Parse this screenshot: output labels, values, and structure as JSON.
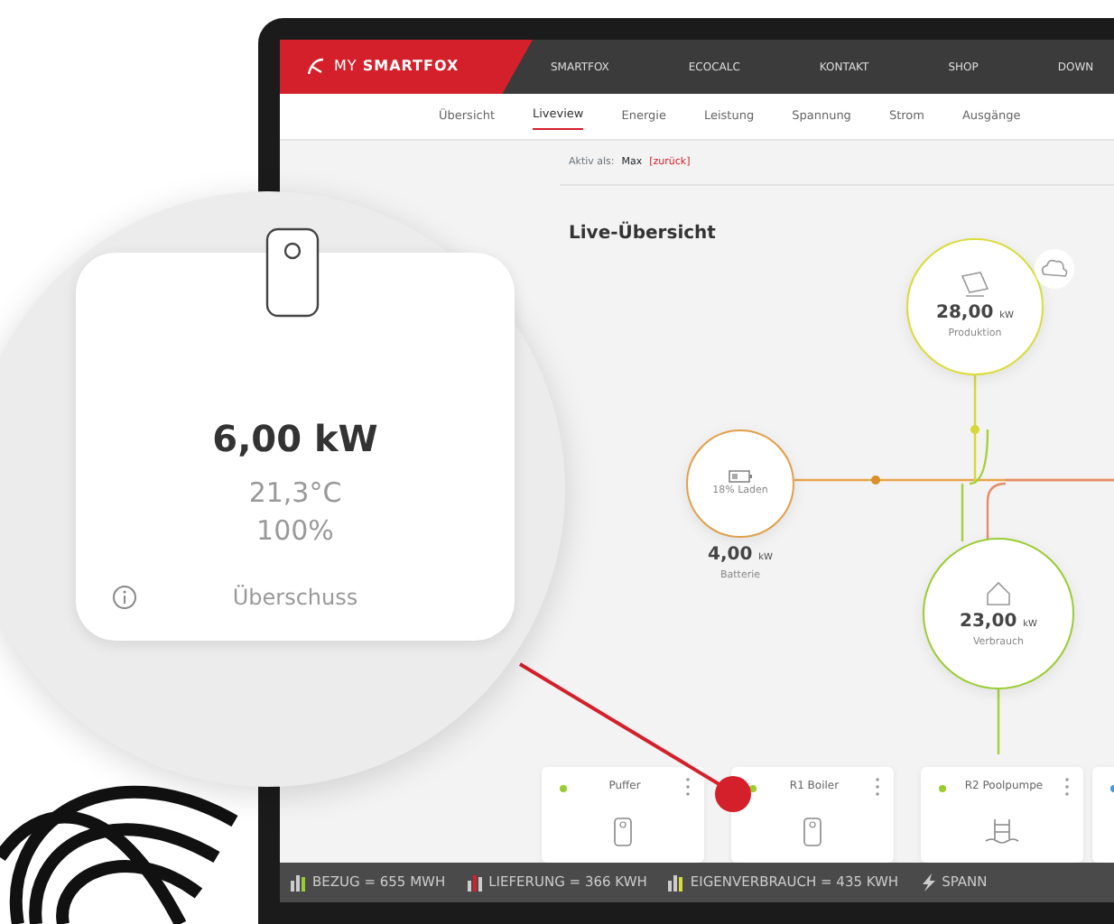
{
  "top_nav": {
    "logo": "MY **SMARTFOX**",
    "items": [
      "SMARTFOX",
      "ECOCALC",
      "KONTAKT",
      "SHOP",
      "DOWN"
    ]
  },
  "sub_nav": [
    {
      "label": "Übersicht",
      "selected": false
    },
    {
      "label": "Liveview",
      "selected": true
    },
    {
      "label": "Energie",
      "selected": false
    },
    {
      "label": "Leistung",
      "selected": false
    },
    {
      "label": "Spannung",
      "selected": false
    },
    {
      "label": "Strom",
      "selected": false
    },
    {
      "label": "Ausgänge",
      "selected": false
    }
  ],
  "user_bar": {
    "label": "Aktiv als:",
    "user": "Max",
    "back_link": "[zurück]"
  },
  "title": "Live-Übersicht",
  "nodes": {
    "production": {
      "value": "28,00",
      "unit": "kW",
      "label": "Produktion"
    },
    "battery": {
      "state": "18% Laden",
      "value": "4,00",
      "unit": "kW",
      "label": "Batterie"
    },
    "consumption": {
      "value": "23,00",
      "unit": "kW",
      "label": "Verbrauch"
    }
  },
  "devices": [
    {
      "name": "Puffer",
      "color": "#9acd32",
      "kind": "tank"
    },
    {
      "name": "R1 Boiler",
      "color": "#9acd32",
      "kind": "tank"
    },
    {
      "name": "R2 Poolpumpe",
      "color": "#9acd32",
      "kind": "pool"
    },
    {
      "color": "#3d9be0",
      "kind": "none"
    }
  ],
  "status_bar": [
    "BEZUG = 655 MWH",
    "LIEFERUNG = 366 KWH",
    "EIGENVERBRAUCH = 435 KWH",
    "SPANN"
  ],
  "magnifier": {
    "power": "6,00 kW",
    "temperature": "21,3°C",
    "percent": "100%",
    "mode": "Überschuss"
  }
}
